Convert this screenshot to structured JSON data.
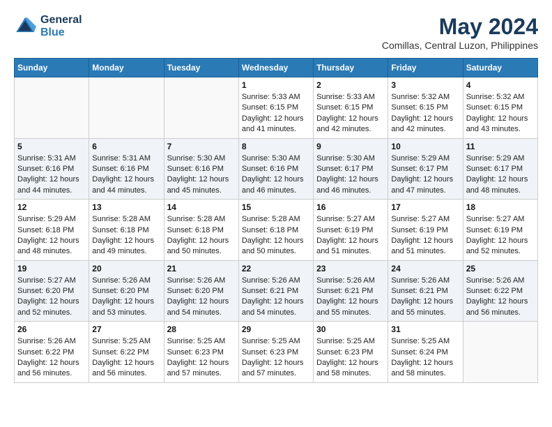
{
  "header": {
    "logo_line1": "General",
    "logo_line2": "Blue",
    "month_year": "May 2024",
    "location": "Comillas, Central Luzon, Philippines"
  },
  "weekdays": [
    "Sunday",
    "Monday",
    "Tuesday",
    "Wednesday",
    "Thursday",
    "Friday",
    "Saturday"
  ],
  "weeks": [
    [
      {
        "day": "",
        "info": ""
      },
      {
        "day": "",
        "info": ""
      },
      {
        "day": "",
        "info": ""
      },
      {
        "day": "1",
        "info": "Sunrise: 5:33 AM\nSunset: 6:15 PM\nDaylight: 12 hours\nand 41 minutes."
      },
      {
        "day": "2",
        "info": "Sunrise: 5:33 AM\nSunset: 6:15 PM\nDaylight: 12 hours\nand 42 minutes."
      },
      {
        "day": "3",
        "info": "Sunrise: 5:32 AM\nSunset: 6:15 PM\nDaylight: 12 hours\nand 42 minutes."
      },
      {
        "day": "4",
        "info": "Sunrise: 5:32 AM\nSunset: 6:15 PM\nDaylight: 12 hours\nand 43 minutes."
      }
    ],
    [
      {
        "day": "5",
        "info": "Sunrise: 5:31 AM\nSunset: 6:16 PM\nDaylight: 12 hours\nand 44 minutes."
      },
      {
        "day": "6",
        "info": "Sunrise: 5:31 AM\nSunset: 6:16 PM\nDaylight: 12 hours\nand 44 minutes."
      },
      {
        "day": "7",
        "info": "Sunrise: 5:30 AM\nSunset: 6:16 PM\nDaylight: 12 hours\nand 45 minutes."
      },
      {
        "day": "8",
        "info": "Sunrise: 5:30 AM\nSunset: 6:16 PM\nDaylight: 12 hours\nand 46 minutes."
      },
      {
        "day": "9",
        "info": "Sunrise: 5:30 AM\nSunset: 6:17 PM\nDaylight: 12 hours\nand 46 minutes."
      },
      {
        "day": "10",
        "info": "Sunrise: 5:29 AM\nSunset: 6:17 PM\nDaylight: 12 hours\nand 47 minutes."
      },
      {
        "day": "11",
        "info": "Sunrise: 5:29 AM\nSunset: 6:17 PM\nDaylight: 12 hours\nand 48 minutes."
      }
    ],
    [
      {
        "day": "12",
        "info": "Sunrise: 5:29 AM\nSunset: 6:18 PM\nDaylight: 12 hours\nand 48 minutes."
      },
      {
        "day": "13",
        "info": "Sunrise: 5:28 AM\nSunset: 6:18 PM\nDaylight: 12 hours\nand 49 minutes."
      },
      {
        "day": "14",
        "info": "Sunrise: 5:28 AM\nSunset: 6:18 PM\nDaylight: 12 hours\nand 50 minutes."
      },
      {
        "day": "15",
        "info": "Sunrise: 5:28 AM\nSunset: 6:18 PM\nDaylight: 12 hours\nand 50 minutes."
      },
      {
        "day": "16",
        "info": "Sunrise: 5:27 AM\nSunset: 6:19 PM\nDaylight: 12 hours\nand 51 minutes."
      },
      {
        "day": "17",
        "info": "Sunrise: 5:27 AM\nSunset: 6:19 PM\nDaylight: 12 hours\nand 51 minutes."
      },
      {
        "day": "18",
        "info": "Sunrise: 5:27 AM\nSunset: 6:19 PM\nDaylight: 12 hours\nand 52 minutes."
      }
    ],
    [
      {
        "day": "19",
        "info": "Sunrise: 5:27 AM\nSunset: 6:20 PM\nDaylight: 12 hours\nand 52 minutes."
      },
      {
        "day": "20",
        "info": "Sunrise: 5:26 AM\nSunset: 6:20 PM\nDaylight: 12 hours\nand 53 minutes."
      },
      {
        "day": "21",
        "info": "Sunrise: 5:26 AM\nSunset: 6:20 PM\nDaylight: 12 hours\nand 54 minutes."
      },
      {
        "day": "22",
        "info": "Sunrise: 5:26 AM\nSunset: 6:21 PM\nDaylight: 12 hours\nand 54 minutes."
      },
      {
        "day": "23",
        "info": "Sunrise: 5:26 AM\nSunset: 6:21 PM\nDaylight: 12 hours\nand 55 minutes."
      },
      {
        "day": "24",
        "info": "Sunrise: 5:26 AM\nSunset: 6:21 PM\nDaylight: 12 hours\nand 55 minutes."
      },
      {
        "day": "25",
        "info": "Sunrise: 5:26 AM\nSunset: 6:22 PM\nDaylight: 12 hours\nand 56 minutes."
      }
    ],
    [
      {
        "day": "26",
        "info": "Sunrise: 5:26 AM\nSunset: 6:22 PM\nDaylight: 12 hours\nand 56 minutes."
      },
      {
        "day": "27",
        "info": "Sunrise: 5:25 AM\nSunset: 6:22 PM\nDaylight: 12 hours\nand 56 minutes."
      },
      {
        "day": "28",
        "info": "Sunrise: 5:25 AM\nSunset: 6:23 PM\nDaylight: 12 hours\nand 57 minutes."
      },
      {
        "day": "29",
        "info": "Sunrise: 5:25 AM\nSunset: 6:23 PM\nDaylight: 12 hours\nand 57 minutes."
      },
      {
        "day": "30",
        "info": "Sunrise: 5:25 AM\nSunset: 6:23 PM\nDaylight: 12 hours\nand 58 minutes."
      },
      {
        "day": "31",
        "info": "Sunrise: 5:25 AM\nSunset: 6:24 PM\nDaylight: 12 hours\nand 58 minutes."
      },
      {
        "day": "",
        "info": ""
      }
    ]
  ]
}
